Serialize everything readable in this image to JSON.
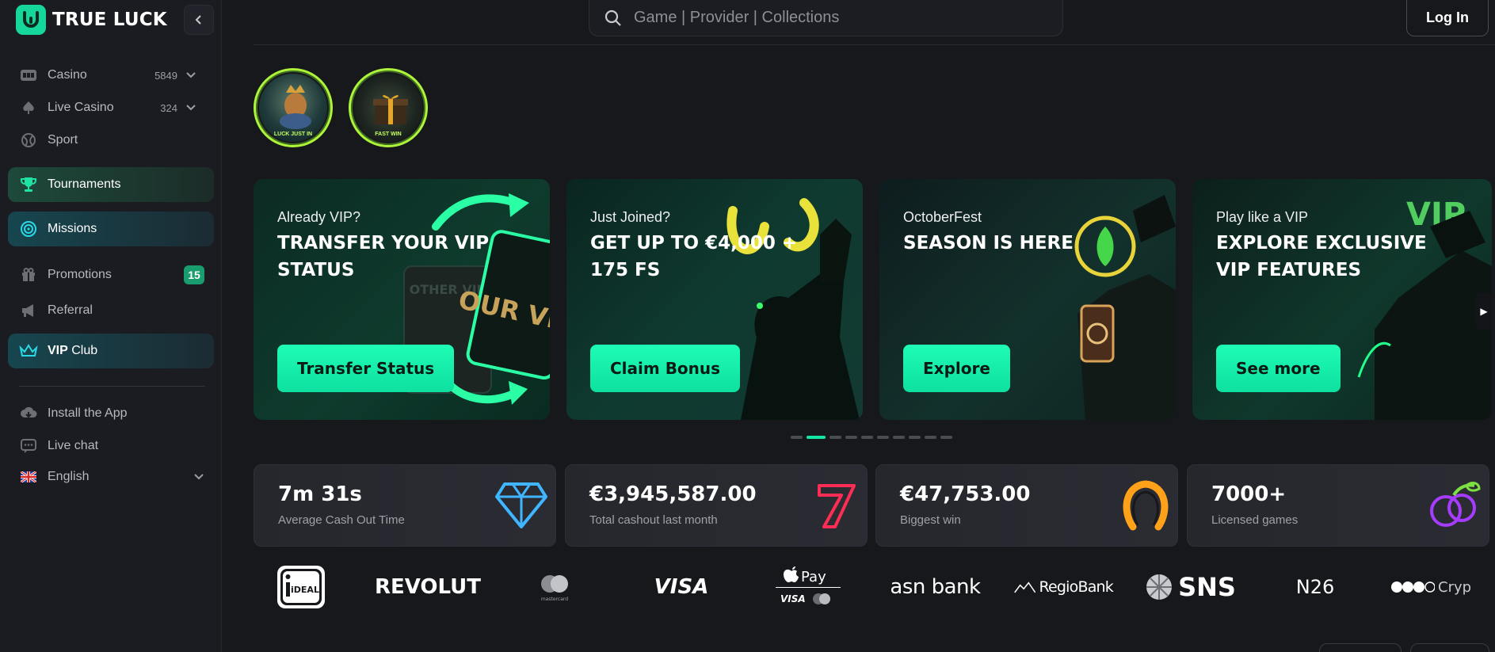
{
  "brand": {
    "name": "TRUE LUCK",
    "accent": "#16d79b"
  },
  "sidebar": {
    "items": [
      {
        "label": "Casino",
        "count": "5849",
        "icon": "slot-machine-icon"
      },
      {
        "label": "Live Casino",
        "count": "324",
        "icon": "spade-icon"
      },
      {
        "label": "Sport",
        "icon": "ball-icon"
      },
      {
        "label": "Tournaments",
        "icon": "trophy-icon"
      },
      {
        "label": "Missions",
        "icon": "target-icon"
      },
      {
        "label": "Promotions",
        "badge": "15",
        "icon": "gift-icon"
      },
      {
        "label": "Referral",
        "icon": "megaphone-icon"
      },
      {
        "label": "VIP Club",
        "label_strong": "VIP",
        "label_rest": " Club",
        "icon": "crown-icon"
      }
    ],
    "footer": [
      {
        "label": "Install the App",
        "icon": "cloud-download-icon"
      },
      {
        "label": "Live chat",
        "icon": "chat-icon"
      },
      {
        "label": "English",
        "icon": "uk-flag-icon"
      }
    ]
  },
  "header": {
    "search_placeholder": "Game | Provider | Collections",
    "login_label": "Log In"
  },
  "stories": [
    {
      "caption": "LUCK JUST IN"
    },
    {
      "caption": "FAST WIN"
    }
  ],
  "banners": [
    {
      "pre": "Already VIP?",
      "title": "TRANSFER YOUR VIP STATUS",
      "cta": "Transfer Status",
      "art_text_1": "OTHER VIP",
      "art_text_2": "OUR VIP"
    },
    {
      "pre": "Just Joined?",
      "title": "GET UP TO €4,000 + 175 FS",
      "cta": "Claim Bonus"
    },
    {
      "pre": "OctoberFest",
      "title": "SEASON IS HERE",
      "cta": "Explore"
    },
    {
      "pre": "Play like a VIP",
      "title": "EXPLORE EXCLUSIVE VIP FEATURES",
      "cta": "See more",
      "art_text": "VIP"
    }
  ],
  "carousel": {
    "active_index": 1,
    "total": 10
  },
  "stats": [
    {
      "value": "7m 31s",
      "label": "Average Cash Out Time",
      "icon": "diamond-icon",
      "color": "#3fb6ff"
    },
    {
      "value": "€3,945,587.00",
      "label": "Total cashout last month",
      "icon": "seven-icon",
      "color": "#ff2d55"
    },
    {
      "value": "€47,753.00",
      "label": "Biggest win",
      "icon": "horseshoe-icon",
      "color": "#ffa21a"
    },
    {
      "value": "7000+",
      "label": "Licensed games",
      "icon": "plum-icon",
      "color": "#a63cff"
    }
  ],
  "payments": {
    "ideal": "iDEAL",
    "revolut": "REVOLUT",
    "mastercard": "mastercard",
    "visa": "VISA",
    "applepay": "Pay",
    "applepay_visa": "VISA",
    "asn": "asn bank",
    "regio": "RegioBank",
    "sns": "SNS",
    "n26": "N26",
    "crypto": "Cryp"
  }
}
